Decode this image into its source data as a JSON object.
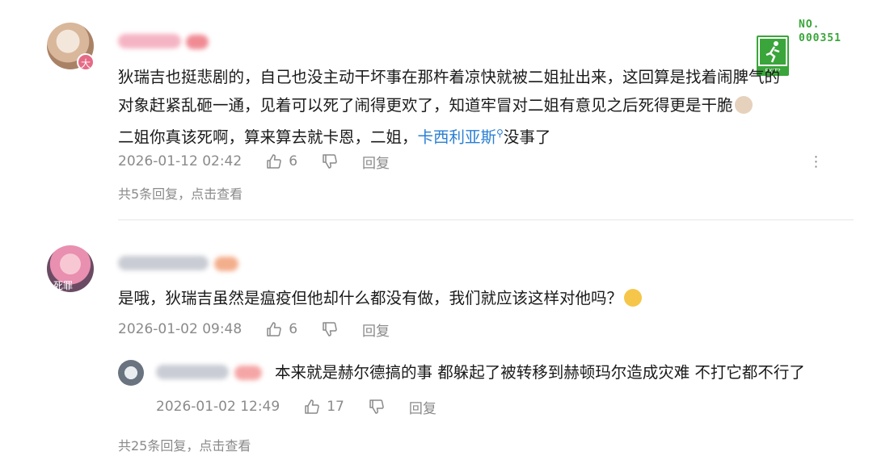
{
  "watermark": {
    "line1": "NO.",
    "line2": "000351",
    "icon": "exit-sign-icon",
    "icon_text": "EXIT?"
  },
  "comments": [
    {
      "avatar_badge": "大",
      "text_lines": [
        "狄瑞吉也挺悲剧的，自己也没主动干坏事在那杵着凉快就被二姐扯出来，这回算是找着闹脾气的",
        "对象赶紧乱砸一通，见着可以死了闹得更欢了，知道牢冒对二姐有意见之后死得更是干脆",
        "二姐你真该死啊，算来算去就卡恩，二姐，"
      ],
      "mention": "卡西利亚斯",
      "line3_suffix": "没事了",
      "date": "2026-01-12 02:42",
      "likes": "6",
      "reply_label": "回复",
      "summary": "共5条回复，点击查看"
    },
    {
      "avatar_label": "死罪",
      "text": "是哦，狄瑞吉虽然是瘟疫但他却什么都没有做，我们就应该这样对他吗？",
      "date": "2026-01-02 09:48",
      "likes": "6",
      "reply_label": "回复",
      "replies": [
        {
          "text": "本来就是赫尔德搞的事 都躲起了被转移到赫顿玛尔造成灾难 不打它都不行了",
          "date": "2026-01-02 12:49",
          "likes": "17",
          "reply_label": "回复"
        }
      ],
      "summary": "共25条回复，点击查看"
    }
  ],
  "colors": {
    "mention": "#2a7fd4",
    "meta": "#8a8a8a",
    "watermark": "#3aa53a"
  }
}
